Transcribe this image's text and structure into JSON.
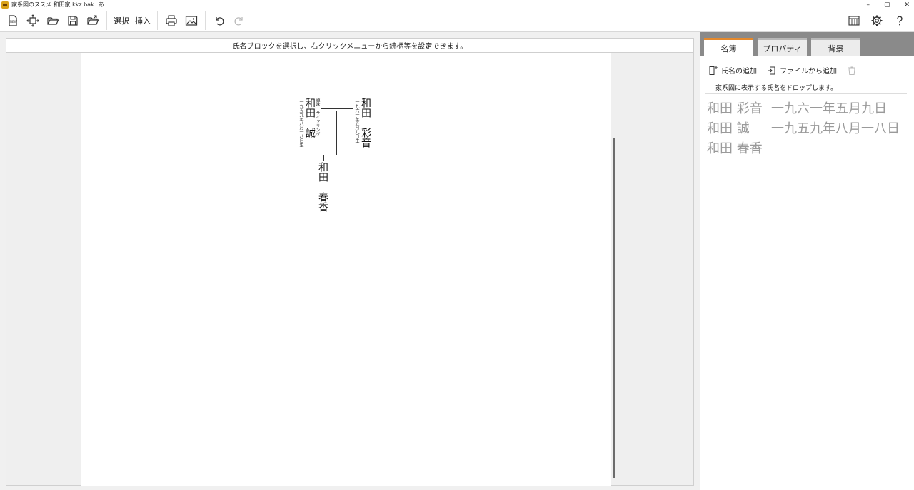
{
  "window": {
    "title": "家系図のススメ 和田家.kkz.bak",
    "ime": "あ",
    "minimize": "–",
    "restore": "▢",
    "close": "✕"
  },
  "toolbar": {
    "select_label": "選択",
    "insert_label": "挿入",
    "new_badge": "NEW"
  },
  "canvas": {
    "hint": "氏名ブロックを選択し、右クリックメニューから続柄等を設定できます。"
  },
  "tree": {
    "husband": {
      "surname": "和田",
      "given": "誠",
      "date": "一九五九年八月一八日生",
      "note": "趣味　サイクリング"
    },
    "wife": {
      "surname": "和田",
      "given": "彩音",
      "date": "一九六一年五月九日生"
    },
    "child": {
      "surname": "和田",
      "given": "春香"
    }
  },
  "sidebar": {
    "tabs": [
      {
        "label": "名簿"
      },
      {
        "label": "プロパティ"
      },
      {
        "label": "背景"
      }
    ],
    "add_name_label": "氏名の追加",
    "add_file_label": "ファイルから追加",
    "drop_hint": "家系図に表示する氏名をドロップします。",
    "roster": [
      {
        "name": "和田 彩音",
        "date": "一九六一年五月九日"
      },
      {
        "name": "和田 誠",
        "date": "一九五九年八月一八日"
      },
      {
        "name": "和田 春香",
        "date": ""
      }
    ]
  }
}
